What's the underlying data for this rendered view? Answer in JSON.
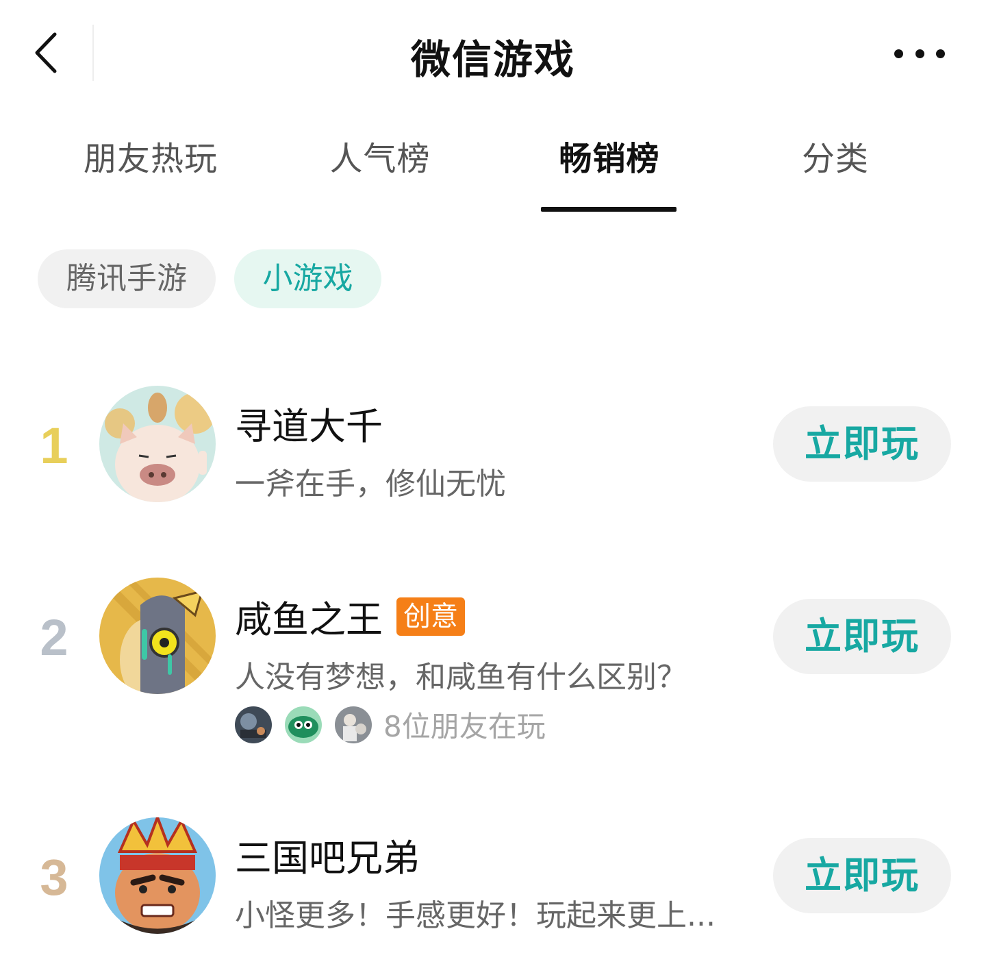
{
  "header": {
    "title": "微信游戏",
    "back_icon": "chevron-left-icon",
    "more_icon": "ellipsis-icon"
  },
  "tabs": [
    {
      "label": "朋友热玩",
      "active": false
    },
    {
      "label": "人气榜",
      "active": false
    },
    {
      "label": "畅销榜",
      "active": true
    },
    {
      "label": "分类",
      "active": false
    }
  ],
  "filters": [
    {
      "label": "腾讯手游",
      "selected": false
    },
    {
      "label": "小游戏",
      "selected": true
    }
  ],
  "games": [
    {
      "rank": "1",
      "rank_color": "#e8cf5a",
      "name": "寻道大千",
      "badge": "",
      "description": "一斧在手，修仙无忧",
      "friends_text": "",
      "play_label": "立即玩"
    },
    {
      "rank": "2",
      "rank_color": "#b9c0c9",
      "name": "咸鱼之王",
      "badge": "创意",
      "description": "人没有梦想，和咸鱼有什么区别？",
      "friends_text": "8位朋友在玩",
      "play_label": "立即玩"
    },
    {
      "rank": "3",
      "rank_color": "#d6b896",
      "name": "三国吧兄弟",
      "badge": "",
      "description": "小怪更多！手感更好！玩起来更上...",
      "friends_text": "",
      "play_label": "立即玩"
    }
  ],
  "colors": {
    "accent": "#17a8a2",
    "badge": "#f57f17",
    "chip_selected_bg": "#e6f7f1"
  }
}
